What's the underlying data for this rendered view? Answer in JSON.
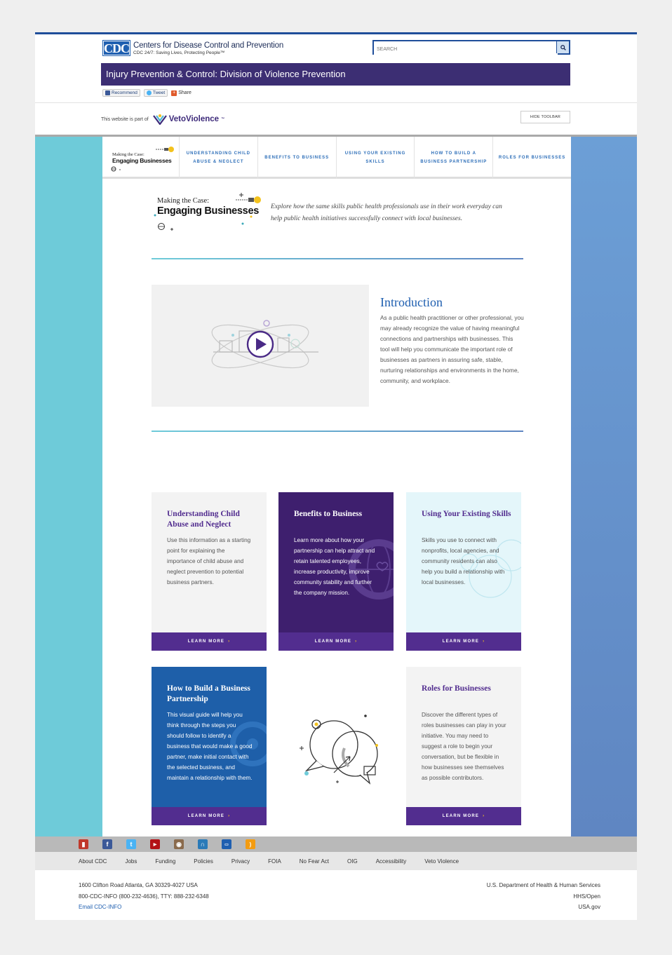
{
  "header": {
    "logo_letters": "CDC",
    "org_name": "Centers for Disease Control and Prevention",
    "tagline": "CDC 24/7: Saving Lives, Protecting People™",
    "search_placeholder": "SEARCH",
    "site_title": "Injury Prevention & Control: Division of Violence Prevention"
  },
  "social": {
    "recommend": "Recommend",
    "tweet": "Tweet",
    "share": "Share"
  },
  "toolbar": {
    "part_of": "This website is part of",
    "veto_brand": "VetoViolence",
    "tm": "™",
    "hide": "HIDE TOOLBAR"
  },
  "nav": {
    "brand_small": "Making the Case:",
    "brand_big": "Engaging Businesses",
    "tabs": [
      "UNDERSTANDING CHILD ABUSE & NEGLECT",
      "BENEFITS TO BUSINESS",
      "USING YOUR EXISTING SKILLS",
      "HOW TO BUILD A BUSINESS PARTNERSHIP",
      "ROLES FOR BUSINESSES"
    ]
  },
  "hero": {
    "small": "Making the Case:",
    "big": "Engaging Businesses",
    "text": "Explore how the same skills public health professionals use in their work everyday can help public health initiatives successfully connect with local businesses."
  },
  "intro": {
    "title": "Introduction",
    "text": "As a public health practitioner or other professional, you may already recognize the value of having meaningful connections and partnerships with businesses. This tool will help you communicate the important role of businesses as partners in assuring safe, stable, nurturing relationships and environments in the home, community, and workplace."
  },
  "cards": [
    {
      "title": "Understanding Child Abuse and Neglect",
      "body": "Use this information as a starting point for explaining the importance of child abuse and neglect prevention to potential business partners.",
      "button": "LEARN MORE"
    },
    {
      "title": "Benefits to Business",
      "body": "Learn more about how your partnership can help attract and retain talented employees, increase productivity, improve community stability and further the company mission.",
      "button": "LEARN MORE"
    },
    {
      "title": "Using Your Existing Skills",
      "body": "Skills you use to connect with nonprofits, local agencies, and community residents can also help you build a relationship with local businesses.",
      "button": "LEARN MORE"
    },
    {
      "title": "How to Build a Business Partnership",
      "body": "This visual guide will help you think through the steps you should follow to identify a business that would make a good partner, make initial contact with the selected business, and maintain a relationship with them.",
      "button": "LEARN MORE"
    },
    {
      "title": "Roles for Businesses",
      "body": "Discover the different types of roles businesses can play in your initiative. You may need to suggest a role to begin your conversation, but be flexible in how businesses see themselves as possible contributors.",
      "button": "LEARN MORE"
    }
  ],
  "footer": {
    "links": [
      "About CDC",
      "Jobs",
      "Funding",
      "Policies",
      "Privacy",
      "FOIA",
      "No Fear Act",
      "OIG",
      "Accessibility",
      "Veto Violence"
    ],
    "address": "1600 Clifton Road Atlanta, GA 30329-4027 USA",
    "phone": "800-CDC-INFO (800-232-4636), TTY: 888-232-6348",
    "email": "Email CDC-INFO",
    "hhs": "U.S. Department of Health & Human Services",
    "hhs_open": "HHS/Open",
    "usa": "USA.gov"
  },
  "colors": {
    "title_bar": "#3c2e73",
    "accent_blue": "#1f5fb0",
    "button_purple": "#522d8f",
    "band_left": "#6ecbd9",
    "band_right": "#5f86c2"
  }
}
